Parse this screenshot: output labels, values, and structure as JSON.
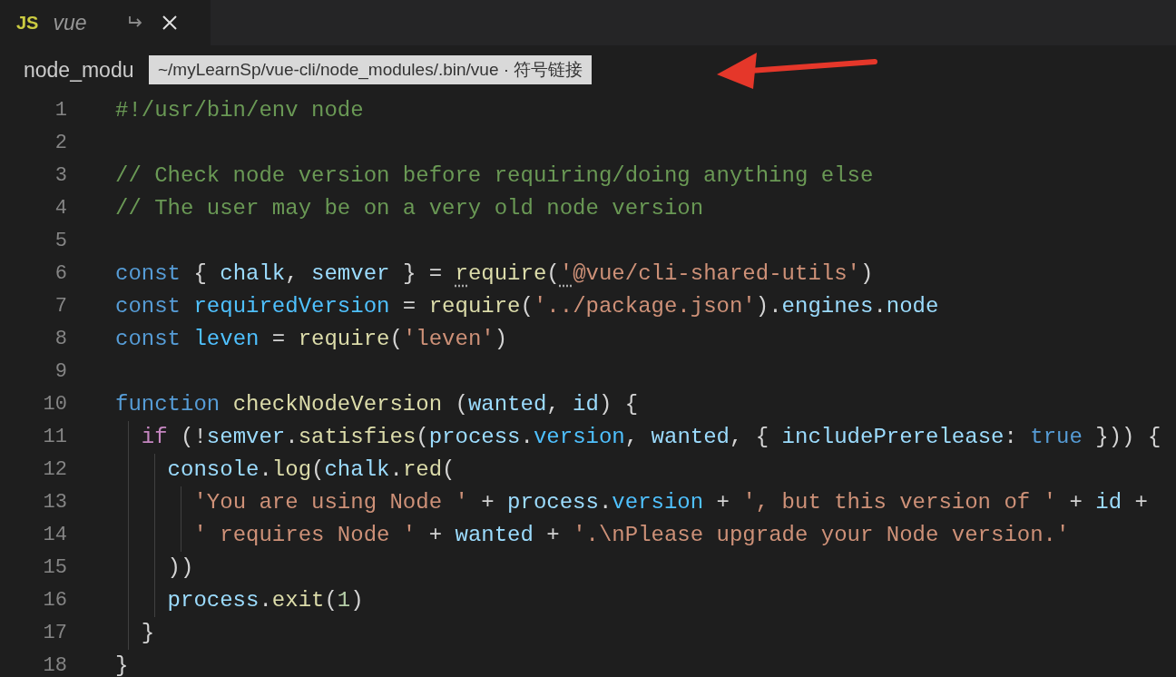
{
  "tab": {
    "icon_text": "JS",
    "label": "vue",
    "preview": true
  },
  "breadcrumb": "node_modu",
  "tooltip": "~/myLearnSp/vue-cli/node_modules/.bin/vue · 符号链接",
  "code_lines": [
    {
      "number": "1",
      "tokens": [
        {
          "kind": "comment",
          "text": "#!/usr/bin/env node"
        }
      ]
    },
    {
      "number": "2"
    },
    {
      "number": "3",
      "tokens": [
        {
          "kind": "comment",
          "text": "// Check node version before requiring/doing anything else"
        }
      ]
    },
    {
      "number": "4",
      "tokens": [
        {
          "kind": "comment",
          "text": "// The user may be on a very old node version"
        }
      ]
    },
    {
      "number": "5"
    },
    {
      "number": "6",
      "tokens": [
        {
          "kind": "keyword",
          "text": "const"
        },
        {
          "kind": "plain",
          "text": " { "
        },
        {
          "kind": "variable",
          "text": "chalk"
        },
        {
          "kind": "plain",
          "text": ", "
        },
        {
          "kind": "variable",
          "text": "semver"
        },
        {
          "kind": "plain",
          "text": " } = "
        },
        {
          "kind": "function",
          "text": "r",
          "hint": true
        },
        {
          "kind": "function",
          "text": "equire"
        },
        {
          "kind": "plain",
          "text": "("
        },
        {
          "kind": "string",
          "text": "'",
          "hint": true
        },
        {
          "kind": "string",
          "text": "@vue/cli-shared-utils'"
        },
        {
          "kind": "plain",
          "text": ")"
        }
      ]
    },
    {
      "number": "7",
      "tokens": [
        {
          "kind": "keyword",
          "text": "const "
        },
        {
          "kind": "constant",
          "text": "requiredVersion"
        },
        {
          "kind": "plain",
          "text": " = "
        },
        {
          "kind": "function",
          "text": "require"
        },
        {
          "kind": "plain",
          "text": "("
        },
        {
          "kind": "string",
          "text": "'../package.json'"
        },
        {
          "kind": "plain",
          "text": ")."
        },
        {
          "kind": "variable",
          "text": "engines"
        },
        {
          "kind": "plain",
          "text": "."
        },
        {
          "kind": "variable",
          "text": "node"
        }
      ]
    },
    {
      "number": "8",
      "tokens": [
        {
          "kind": "keyword",
          "text": "const "
        },
        {
          "kind": "constant",
          "text": "leven"
        },
        {
          "kind": "plain",
          "text": " = "
        },
        {
          "kind": "function",
          "text": "require"
        },
        {
          "kind": "plain",
          "text": "("
        },
        {
          "kind": "string",
          "text": "'leven'"
        },
        {
          "kind": "plain",
          "text": ")"
        }
      ]
    },
    {
      "number": "9"
    },
    {
      "number": "10",
      "tokens": [
        {
          "kind": "keyword",
          "text": "function "
        },
        {
          "kind": "function",
          "text": "checkNodeVersion"
        },
        {
          "kind": "plain",
          "text": " ("
        },
        {
          "kind": "variable",
          "text": "wanted"
        },
        {
          "kind": "plain",
          "text": ", "
        },
        {
          "kind": "variable",
          "text": "id"
        },
        {
          "kind": "plain",
          "text": ") {"
        }
      ],
      "children": [
        {
          "number": "11",
          "tokens": [
            {
              "kind": "control",
              "text": "if"
            },
            {
              "kind": "plain",
              "text": " (!"
            },
            {
              "kind": "variable",
              "text": "semver"
            },
            {
              "kind": "plain",
              "text": "."
            },
            {
              "kind": "function",
              "text": "satisfies"
            },
            {
              "kind": "plain",
              "text": "("
            },
            {
              "kind": "variable",
              "text": "process"
            },
            {
              "kind": "plain",
              "text": "."
            },
            {
              "kind": "support",
              "text": "version"
            },
            {
              "kind": "plain",
              "text": ", "
            },
            {
              "kind": "variable",
              "text": "wanted"
            },
            {
              "kind": "plain",
              "text": ", { "
            },
            {
              "kind": "variable",
              "text": "includePrerelease"
            },
            {
              "kind": "plain",
              "text": ": "
            },
            {
              "kind": "keyword",
              "text": "true"
            },
            {
              "kind": "plain",
              "text": " })) {"
            }
          ],
          "children": [
            {
              "number": "12",
              "tokens": [
                {
                  "kind": "variable",
                  "text": "console"
                },
                {
                  "kind": "plain",
                  "text": "."
                },
                {
                  "kind": "function",
                  "text": "log"
                },
                {
                  "kind": "plain",
                  "text": "("
                },
                {
                  "kind": "variable",
                  "text": "chalk"
                },
                {
                  "kind": "plain",
                  "text": "."
                },
                {
                  "kind": "function",
                  "text": "red"
                },
                {
                  "kind": "plain",
                  "text": "("
                }
              ],
              "children": [
                {
                  "number": "13",
                  "tokens": [
                    {
                      "kind": "string",
                      "text": "'You are using Node '"
                    },
                    {
                      "kind": "plain",
                      "text": " + "
                    },
                    {
                      "kind": "variable",
                      "text": "process"
                    },
                    {
                      "kind": "plain",
                      "text": "."
                    },
                    {
                      "kind": "support",
                      "text": "version"
                    },
                    {
                      "kind": "plain",
                      "text": " + "
                    },
                    {
                      "kind": "string",
                      "text": "', but this version of '"
                    },
                    {
                      "kind": "plain",
                      "text": " + "
                    },
                    {
                      "kind": "variable",
                      "text": "id"
                    },
                    {
                      "kind": "plain",
                      "text": " +"
                    }
                  ]
                },
                {
                  "number": "14",
                  "tokens": [
                    {
                      "kind": "string",
                      "text": "' requires Node '"
                    },
                    {
                      "kind": "plain",
                      "text": " + "
                    },
                    {
                      "kind": "variable",
                      "text": "wanted"
                    },
                    {
                      "kind": "plain",
                      "text": " + "
                    },
                    {
                      "kind": "string",
                      "text": "'.\\nPlease upgrade your Node version.'"
                    }
                  ]
                }
              ]
            },
            {
              "number": "15",
              "tokens": [
                {
                  "kind": "plain",
                  "text": "))"
                }
              ]
            },
            {
              "number": "16",
              "tokens": [
                {
                  "kind": "variable",
                  "text": "process"
                },
                {
                  "kind": "plain",
                  "text": "."
                },
                {
                  "kind": "function",
                  "text": "exit"
                },
                {
                  "kind": "plain",
                  "text": "("
                },
                {
                  "kind": "number",
                  "text": "1"
                },
                {
                  "kind": "plain",
                  "text": ")"
                }
              ]
            }
          ]
        },
        {
          "number": "17",
          "tokens": [
            {
              "kind": "plain",
              "text": "}"
            }
          ]
        }
      ]
    },
    {
      "number": "18",
      "tokens": [
        {
          "kind": "plain",
          "text": "}"
        }
      ]
    }
  ]
}
